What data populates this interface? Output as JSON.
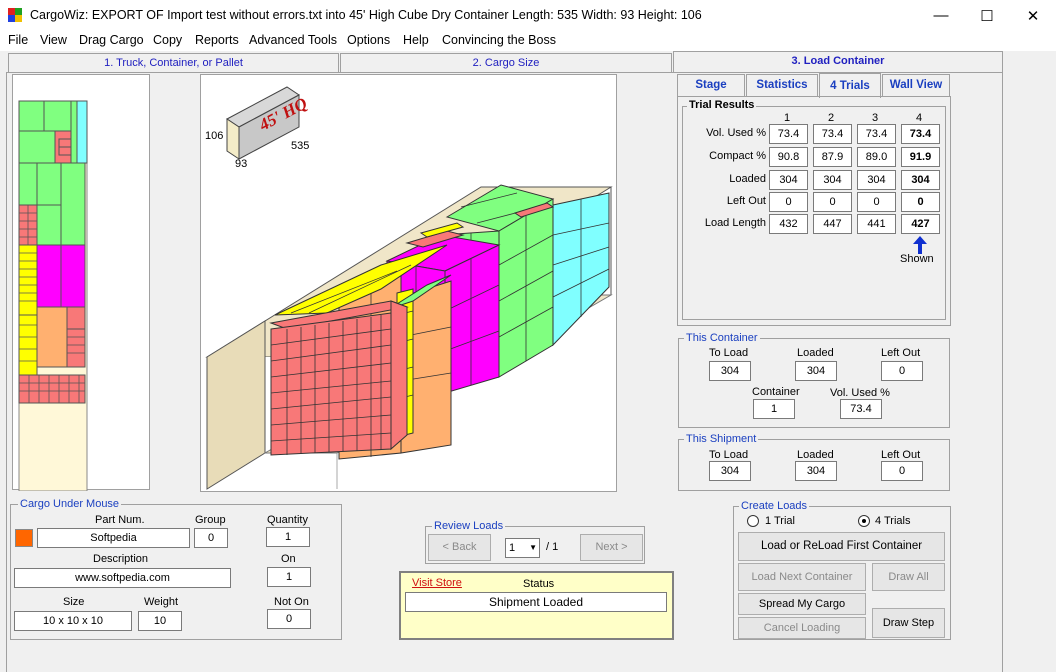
{
  "window": {
    "title": "CargoWiz:  EXPORT OF Import test without errors.txt into  45' High Cube Dry Container  Length: 535  Width: 93  Height: 106",
    "minimize": "—",
    "maximize": "☐",
    "close": "✕"
  },
  "menu": [
    "File",
    "View",
    "Drag Cargo",
    "Copy",
    "Reports",
    "Advanced Tools",
    "Options",
    "Help",
    "Convincing the Boss"
  ],
  "tabs": [
    "1. Truck, Container, or Pallet",
    "2. Cargo Size",
    "3. Load Container"
  ],
  "container_badge": {
    "label": "45' HQ",
    "height": "106",
    "width": "93",
    "length": "535"
  },
  "subtabs": [
    "Stage",
    "Statistics",
    "4 Trials",
    "Wall View"
  ],
  "trial_results": {
    "title": "Trial Results",
    "columns": [
      "1",
      "2",
      "3",
      "4"
    ],
    "rows": [
      {
        "label": "Vol. Used %",
        "values": [
          "73.4",
          "73.4",
          "73.4",
          "73.4"
        ]
      },
      {
        "label": "Compact %",
        "values": [
          "90.8",
          "87.9",
          "89.0",
          "91.9"
        ]
      },
      {
        "label": "Loaded",
        "values": [
          "304",
          "304",
          "304",
          "304"
        ]
      },
      {
        "label": "Left Out",
        "values": [
          "0",
          "0",
          "0",
          "0"
        ]
      },
      {
        "label": "Load Length",
        "values": [
          "432",
          "447",
          "441",
          "427"
        ]
      }
    ],
    "shown_label": "Shown"
  },
  "this_container": {
    "title": "This Container",
    "to_load_label": "To Load",
    "to_load": "304",
    "loaded_label": "Loaded",
    "loaded": "304",
    "left_out_label": "Left Out",
    "left_out": "0",
    "container_label": "Container",
    "container": "1",
    "vol_used_label": "Vol. Used %",
    "vol_used": "73.4"
  },
  "this_shipment": {
    "title": "This Shipment",
    "to_load_label": "To Load",
    "to_load": "304",
    "loaded_label": "Loaded",
    "loaded": "304",
    "left_out_label": "Left Out",
    "left_out": "0"
  },
  "cargo_under_mouse": {
    "title": "Cargo Under Mouse",
    "part_num_label": "Part Num.",
    "part_num": "Softpedia",
    "group_label": "Group",
    "group": "0",
    "quantity_label": "Quantity",
    "quantity": "1",
    "description_label": "Description",
    "description": "www.softpedia.com",
    "on_label": "On",
    "on": "1",
    "size_label": "Size",
    "size": "10 x 10 x 10",
    "weight_label": "Weight",
    "weight": "10",
    "not_on_label": "Not On",
    "not_on": "0",
    "swatch_color": "#ff6600"
  },
  "review_loads": {
    "title": "Review Loads",
    "back": "< Back",
    "next": "Next >",
    "selected": "1",
    "of": "/ 1"
  },
  "status_box": {
    "visit_store": "Visit Store",
    "status_label": "Status",
    "status": "Shipment Loaded"
  },
  "create_loads": {
    "title": "Create Loads",
    "option1": "1 Trial",
    "option2": "4 Trials",
    "selected": "4 Trials",
    "load_first": "Load or ReLoad First Container",
    "load_next": "Load Next Container",
    "draw_all": "Draw All",
    "spread": "Spread My Cargo",
    "cancel": "Cancel Loading",
    "draw_step": "Draw Step"
  },
  "colors": {
    "salmon": "#f87878",
    "yellow": "#ffff00",
    "magenta": "#ff00ff",
    "orange": "#ffb070",
    "green": "#80ff80",
    "cyan": "#80ffff",
    "floor": "#f0e6c8",
    "accent_blue": "#1a3fc0"
  }
}
